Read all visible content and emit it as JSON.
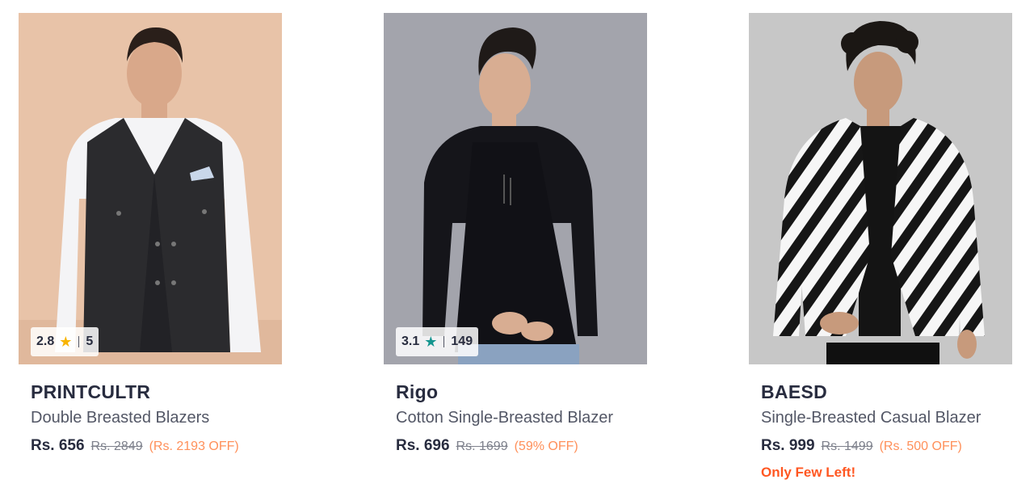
{
  "colors": {
    "discount": "#ff905a",
    "few_left": "#ff5722",
    "star_gold": "#f8b400",
    "star_green": "#14958f"
  },
  "products": [
    {
      "brand": "PRINTCULTR",
      "name": "Double Breasted Blazers",
      "price": "Rs. 656",
      "mrp": "Rs. 2849",
      "discount": "(Rs. 2193 OFF)",
      "rating": "2.8",
      "rating_count": "5",
      "star_icon": "star-icon-gold",
      "stock_note": ""
    },
    {
      "brand": "Rigo",
      "name": "Cotton Single-Breasted Blazer",
      "price": "Rs. 696",
      "mrp": "Rs. 1699",
      "discount": "(59% OFF)",
      "rating": "3.1",
      "rating_count": "149",
      "star_icon": "star-icon-green",
      "stock_note": ""
    },
    {
      "brand": "BAESD",
      "name": "Single-Breasted Casual Blazer",
      "price": "Rs. 999",
      "mrp": "Rs. 1499",
      "discount": "(Rs. 500 OFF)",
      "rating": "",
      "rating_count": "",
      "star_icon": "",
      "stock_note": "Only Few Left!"
    }
  ]
}
